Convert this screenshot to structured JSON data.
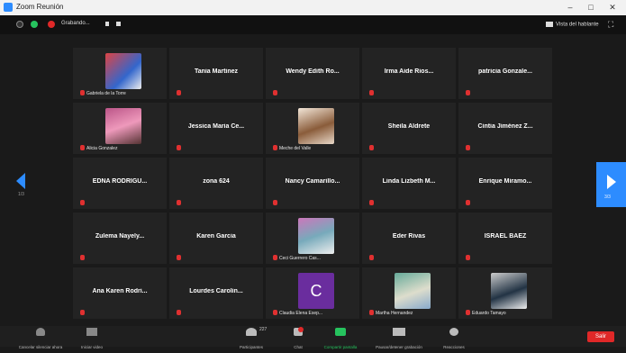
{
  "window": {
    "title": "Zoom Reunión",
    "controls": [
      "–",
      "□",
      "✕"
    ]
  },
  "top_bar": {
    "recording": "Grabando...",
    "view_button": "Vista del hablante"
  },
  "grid": {
    "rows": [
      [
        "Gabriela de la Torre",
        "Tania Martinez",
        "Wendy Edith Ro...",
        "Irma Aide Rios...",
        "patricia Gonzale..."
      ],
      [
        "Alicia Gonzalez",
        "Jessica Maria Ce...",
        "Meche del Valle",
        "Sheila Aldrete",
        "Cintia Jiménez Z..."
      ],
      [
        "EDNA RODRIGU...",
        "zona 624",
        "Nancy Camarillo...",
        "Linda Lizbeth M...",
        "Enrique Miramo..."
      ],
      [
        "Zulema Nayely...",
        "Karen Garcia",
        "Ceci Guerrero Cas...",
        "Eder Rivas",
        "ISRAEL BAEZ"
      ],
      [
        "Ana Karen Rodri...",
        "Lourdes Carolin...",
        "Claudia Elena Esep...",
        "Martha Hernandez",
        "Eduardo Tamayo"
      ]
    ],
    "photo_tiles": [
      "Gabriela de la Torre",
      "Alicia Gonzalez",
      "Meche del Valle",
      "Ceci Guerrero Cas...",
      "Martha Hernandez",
      "Eduardo Tamayo"
    ],
    "initial_tile": {
      "name": "Claudia Elena Esep...",
      "initial": "C"
    }
  },
  "nav": {
    "left_page": "1/3",
    "right_page": "3/3"
  },
  "toolbar": {
    "mute": "Cancelar silenciar ahora",
    "video": "Iniciar video",
    "participants": "Participantes",
    "participants_count": "227",
    "chat": "Chat",
    "share": "Compartir pantalla",
    "record": "Pausar/detener grabación",
    "reactions": "Reacciones",
    "leave": "Salir"
  },
  "colors": {
    "accent": "#2d8cff",
    "leave": "#e02828",
    "share": "#26c35e"
  }
}
